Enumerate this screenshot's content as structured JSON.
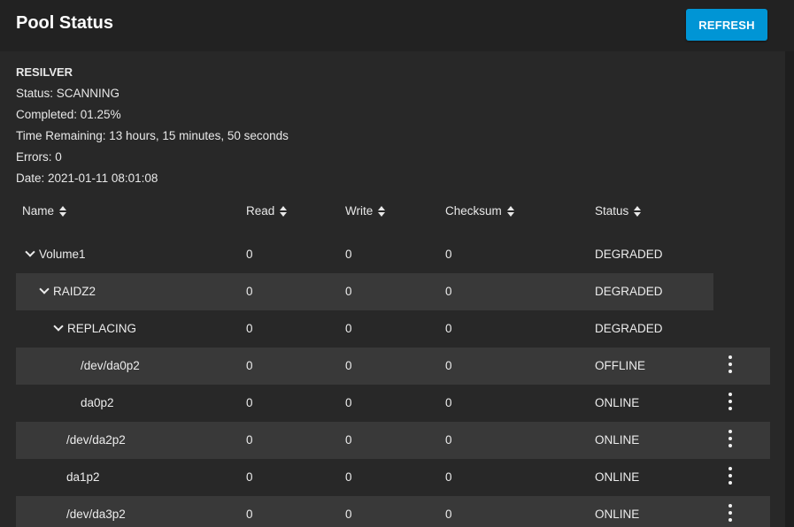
{
  "header": {
    "title": "Pool Status",
    "refresh_label": "REFRESH"
  },
  "scan": {
    "heading": "RESILVER",
    "status": "Status: SCANNING",
    "completed": "Completed: 01.25%",
    "time_remaining": "Time Remaining: 13 hours, 15 minutes, 50 seconds",
    "errors": "Errors: 0",
    "date": "Date: 2021-01-11 08:01:08"
  },
  "table": {
    "columns": [
      "Name",
      "Read",
      "Write",
      "Checksum",
      "Status"
    ],
    "rows": [
      {
        "name": "Volume1",
        "read": "0",
        "write": "0",
        "checksum": "0",
        "status": "DEGRADED"
      },
      {
        "name": "RAIDZ2",
        "read": "0",
        "write": "0",
        "checksum": "0",
        "status": "DEGRADED"
      },
      {
        "name": "REPLACING",
        "read": "0",
        "write": "0",
        "checksum": "0",
        "status": "DEGRADED"
      },
      {
        "name": "/dev/da0p2",
        "read": "0",
        "write": "0",
        "checksum": "0",
        "status": "OFFLINE"
      },
      {
        "name": "da0p2",
        "read": "0",
        "write": "0",
        "checksum": "0",
        "status": "ONLINE"
      },
      {
        "name": "/dev/da2p2",
        "read": "0",
        "write": "0",
        "checksum": "0",
        "status": "ONLINE"
      },
      {
        "name": "da1p2",
        "read": "0",
        "write": "0",
        "checksum": "0",
        "status": "ONLINE"
      },
      {
        "name": "/dev/da3p2",
        "read": "0",
        "write": "0",
        "checksum": "0",
        "status": "ONLINE"
      }
    ]
  },
  "colors": {
    "accent": "#0095d5",
    "background": "#1e1e1e",
    "card": "#282828",
    "row_shade": "#393939"
  }
}
